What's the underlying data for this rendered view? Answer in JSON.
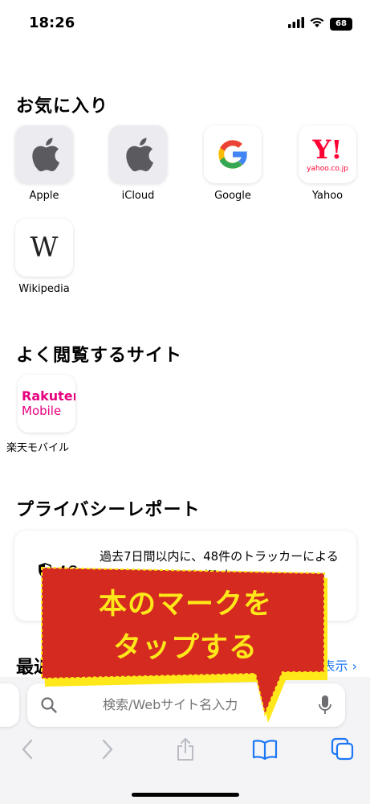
{
  "status": {
    "time": "18:26",
    "battery": "68"
  },
  "favorites": {
    "title": "お気に入り",
    "items": [
      {
        "label": "Apple",
        "icon": "apple-logo-icon"
      },
      {
        "label": "iCloud",
        "icon": "apple-logo-icon"
      },
      {
        "label": "Google",
        "icon": "google-logo-icon"
      },
      {
        "label": "Yahoo",
        "icon": "yahoo-logo-icon",
        "logo_text": "Y!",
        "logo_sub": "yahoo.co.jp"
      },
      {
        "label": "Wikipedia",
        "icon": "wikipedia-logo-icon",
        "logo_text": "W"
      }
    ]
  },
  "frequent": {
    "title": "よく閲覧するサイト",
    "items": [
      {
        "label": "楽天モバイル",
        "logo_line1": "Rakuten",
        "logo_line2": "Mobile",
        "color": "#e6007e"
      }
    ]
  },
  "privacy": {
    "title": "プライバシーレポート",
    "count": "48",
    "text": "過去7日間以内に、48件のトラッカーによるプロファイリングが阻止"
  },
  "recent": {
    "title_fragment": "最近",
    "show_link": "表示 ›"
  },
  "search": {
    "placeholder": "検索/Webサイト名入力"
  },
  "callout": {
    "line1": "本のマークを",
    "line2": "タップする",
    "fill": "#d42a20",
    "text_color": "#ffe81a",
    "outline": "#ffe81a"
  },
  "colors": {
    "accent": "#1e78f5"
  }
}
